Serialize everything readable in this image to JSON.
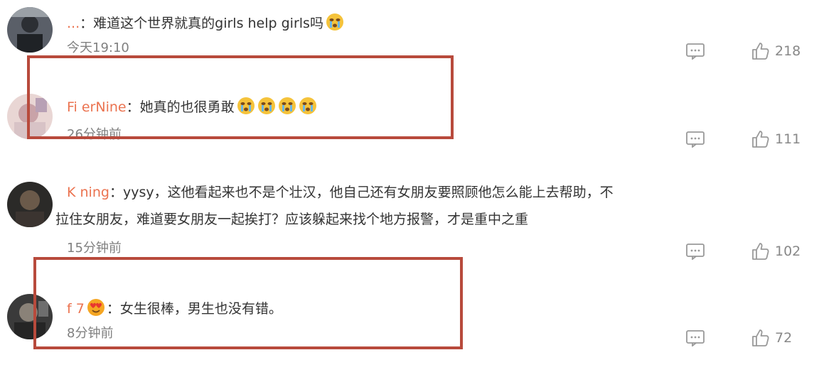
{
  "colors": {
    "username": "#eb7350",
    "highlight_box": "#b84a3c",
    "meta": "#808080"
  },
  "comments": [
    {
      "user": "...",
      "separator": "：",
      "text": "难道这个世界就真的girls help girls吗",
      "emojis": [
        "crying-face"
      ],
      "time": "今天19:10",
      "likes": "218"
    },
    {
      "user": "Fi          erNine",
      "separator": "：",
      "text": "她真的也很勇敢",
      "emojis": [
        "crying-face",
        "crying-face",
        "crying-face",
        "crying-face"
      ],
      "time": "26分钟前",
      "likes": "111"
    },
    {
      "user": "K                 ning",
      "separator": "：",
      "text": "yysy，这他看起来也不是个壮汉，他自己还有女朋友要照顾他怎么能上去帮助，不",
      "text_cont": "拉住女朋友，难道要女朋友一起挨打？应该躲起来找个地方报警，才是重中之重",
      "time": "15分钟前",
      "likes": "102"
    },
    {
      "user": "f         7",
      "separator": "：",
      "text": "女生很棒，男生也没有错。",
      "badge": "heart-eyes",
      "time": "8分钟前",
      "likes": "72"
    }
  ]
}
